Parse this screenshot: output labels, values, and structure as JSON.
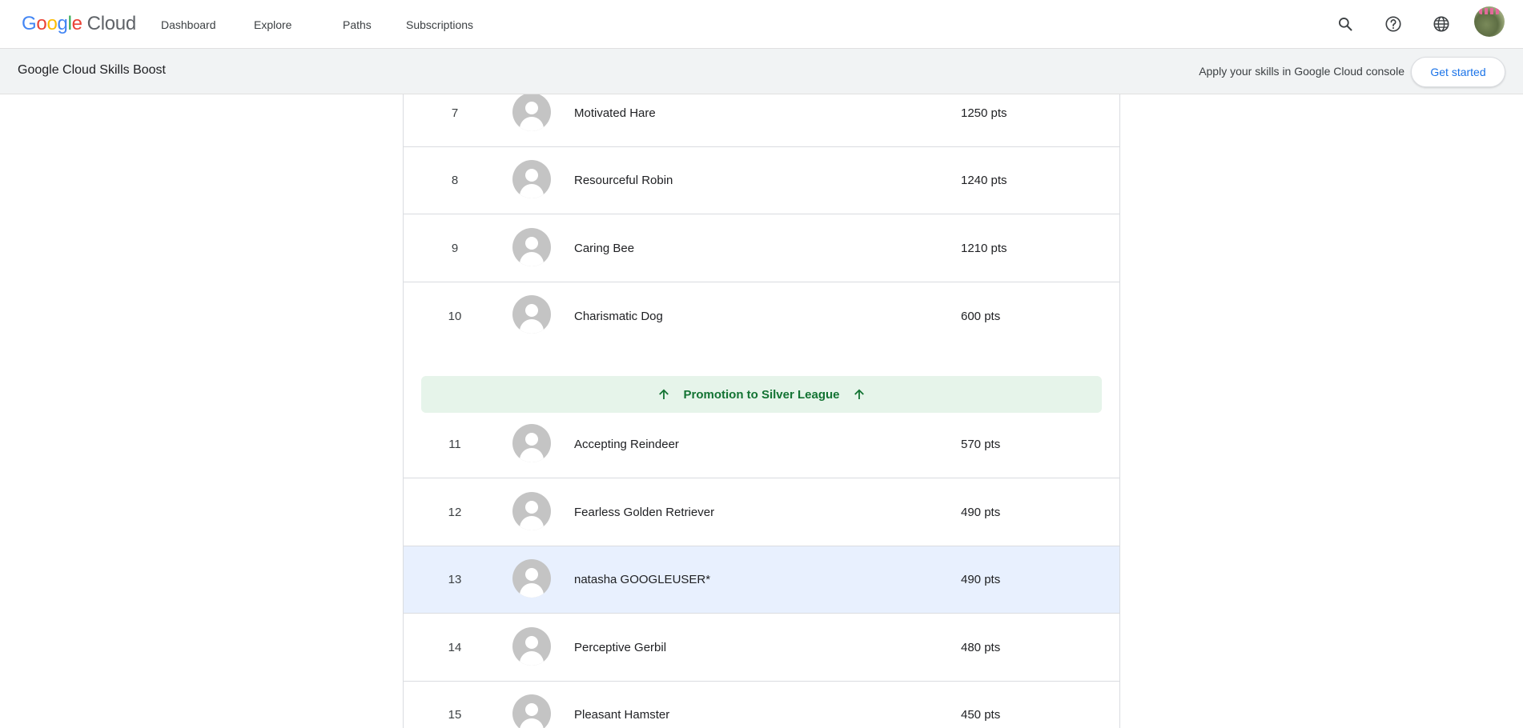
{
  "header": {
    "logo_google": "Google",
    "logo_cloud": "Cloud",
    "nav": [
      "Dashboard",
      "Explore",
      "Paths",
      "Subscriptions"
    ],
    "icons": [
      "search-icon",
      "help-icon",
      "globe-icon",
      "user-avatar"
    ]
  },
  "subbar": {
    "title": "Google Cloud Skills Boost",
    "apply_text": "Apply your skills in Google Cloud console",
    "cta_label": "Get started"
  },
  "leaderboard": {
    "rows_top": [
      {
        "rank": "7",
        "name": "Motivated Hare",
        "points": "1250 pts"
      },
      {
        "rank": "8",
        "name": "Resourceful Robin",
        "points": "1240 pts"
      },
      {
        "rank": "9",
        "name": "Caring Bee",
        "points": "1210 pts"
      },
      {
        "rank": "10",
        "name": "Charismatic Dog",
        "points": "600 pts"
      }
    ],
    "promotion_label": "Promotion to Silver League",
    "rows_bottom": [
      {
        "rank": "11",
        "name": "Accepting Reindeer",
        "points": "570 pts"
      },
      {
        "rank": "12",
        "name": "Fearless Golden Retriever",
        "points": "490 pts"
      },
      {
        "rank": "13",
        "name": "natasha GOOGLEUSER*",
        "points": "490 pts",
        "current_user": true
      },
      {
        "rank": "14",
        "name": "Perceptive Gerbil",
        "points": "480 pts"
      },
      {
        "rank": "15",
        "name": "Pleasant Hamster",
        "points": "450 pts"
      }
    ]
  },
  "colors": {
    "accent": "#1a73e8",
    "promotion_bg": "#e6f4ea",
    "promotion_text": "#137333",
    "highlight_row": "#e8f0fe"
  }
}
